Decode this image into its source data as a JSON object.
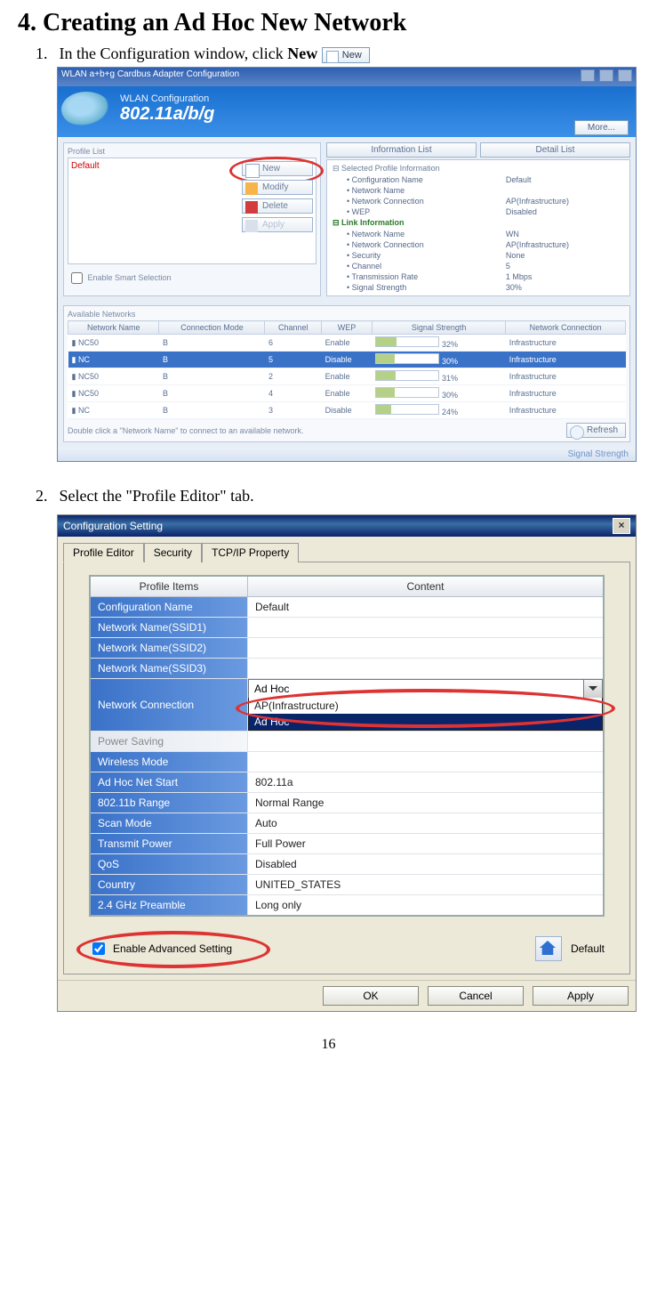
{
  "heading": "4. Creating an Ad Hoc New Network",
  "steps": {
    "s1_num": "1.",
    "s1_text_a": "In the Configuration window, click ",
    "s1_text_b": "New",
    "s2_num": "2.",
    "s2_text": "Select the \"Profile Editor\" tab."
  },
  "inline_new_btn": "New",
  "shot1": {
    "title": "WLAN a+b+g Cardbus Adapter Configuration",
    "banner_small": "WLAN Configuration",
    "banner_big": "802.11a/b/g",
    "more_btn": "More...",
    "profile_group": "Profile List",
    "profile_default": "Default",
    "btn_new": "New",
    "btn_modify": "Modify",
    "btn_delete": "Delete",
    "btn_apply": "Apply",
    "smart_label": "Enable Smart Selection",
    "tab_info": "Information List",
    "tab_detail": "Detail List",
    "info": {
      "h1": "Selected Profile Information",
      "r1k": "Configuration Name",
      "r1v": "Default",
      "r2k": "Network Name",
      "r2v": "",
      "r3k": "Network Connection",
      "r3v": "AP(Infrastructure)",
      "r4k": "WEP",
      "r4v": "Disabled",
      "h2": "Link Information",
      "r5k": "Network Name",
      "r5v": "WN",
      "r6k": "Network Connection",
      "r6v": "AP(Infrastructure)",
      "r7k": "Security",
      "r7v": "None",
      "r8k": "Channel",
      "r8v": "5",
      "r9k": "Transmission Rate",
      "r9v": "1 Mbps",
      "r10k": "Signal Strength",
      "r10v": "30%"
    },
    "avail_label": "Available Networks",
    "cols": {
      "c1": "Network Name",
      "c2": "Connection Mode",
      "c3": "Channel",
      "c4": "WEP",
      "c5": "Signal Strength",
      "c6": "Network Connection"
    },
    "rows": [
      {
        "n": "NC50",
        "m": "B",
        "ch": "6",
        "w": "Enable",
        "s": "32%",
        "sw": "32",
        "nc": "Infrastructure",
        "sel": false
      },
      {
        "n": "NC",
        "m": "B",
        "ch": "5",
        "w": "Disable",
        "s": "30%",
        "sw": "30",
        "nc": "Infrastructure",
        "sel": true
      },
      {
        "n": "NC50",
        "m": "B",
        "ch": "2",
        "w": "Enable",
        "s": "31%",
        "sw": "31",
        "nc": "Infrastructure",
        "sel": false
      },
      {
        "n": "NC50",
        "m": "B",
        "ch": "4",
        "w": "Enable",
        "s": "30%",
        "sw": "30",
        "nc": "Infrastructure",
        "sel": false
      },
      {
        "n": "NC",
        "m": "B",
        "ch": "3",
        "w": "Disable",
        "s": "24%",
        "sw": "24",
        "nc": "Infrastructure",
        "sel": false
      }
    ],
    "note": "Double click a \"Network Name\" to connect to an available network.",
    "refresh": "Refresh",
    "foot": "Signal Strength"
  },
  "shot2": {
    "title": "Configuration Setting",
    "tabs": {
      "t1": "Profile Editor",
      "t2": "Security",
      "t3": "TCP/IP Property"
    },
    "col_items": "Profile Items",
    "col_content": "Content",
    "rows": {
      "cfg": {
        "k": "Configuration Name",
        "v": "Default"
      },
      "ssid1": {
        "k": "Network Name(SSID1)",
        "v": ""
      },
      "ssid2": {
        "k": "Network Name(SSID2)",
        "v": ""
      },
      "ssid3": {
        "k": "Network Name(SSID3)",
        "v": ""
      },
      "nc": {
        "k": "Network Connection",
        "v": "Ad Hoc",
        "opt1": "AP(Infrastructure)",
        "opt2": "Ad Hoc"
      },
      "ps": {
        "k": "Power Saving",
        "v": ""
      },
      "wm": {
        "k": "Wireless Mode",
        "v": ""
      },
      "ahs": {
        "k": "Ad Hoc Net Start",
        "v": "802.11a"
      },
      "rng": {
        "k": "802.11b Range",
        "v": "Normal Range"
      },
      "sm": {
        "k": "Scan Mode",
        "v": "Auto"
      },
      "tp": {
        "k": "Transmit Power",
        "v": "Full Power"
      },
      "qos": {
        "k": "QoS",
        "v": "Disabled"
      },
      "cty": {
        "k": "Country",
        "v": "UNITED_STATES"
      },
      "pre": {
        "k": "2.4 GHz Preamble",
        "v": "Long only"
      }
    },
    "adv_label": "Enable Advanced Setting",
    "default_label": "Default",
    "ok": "OK",
    "cancel": "Cancel",
    "apply": "Apply"
  },
  "page_number": "16"
}
